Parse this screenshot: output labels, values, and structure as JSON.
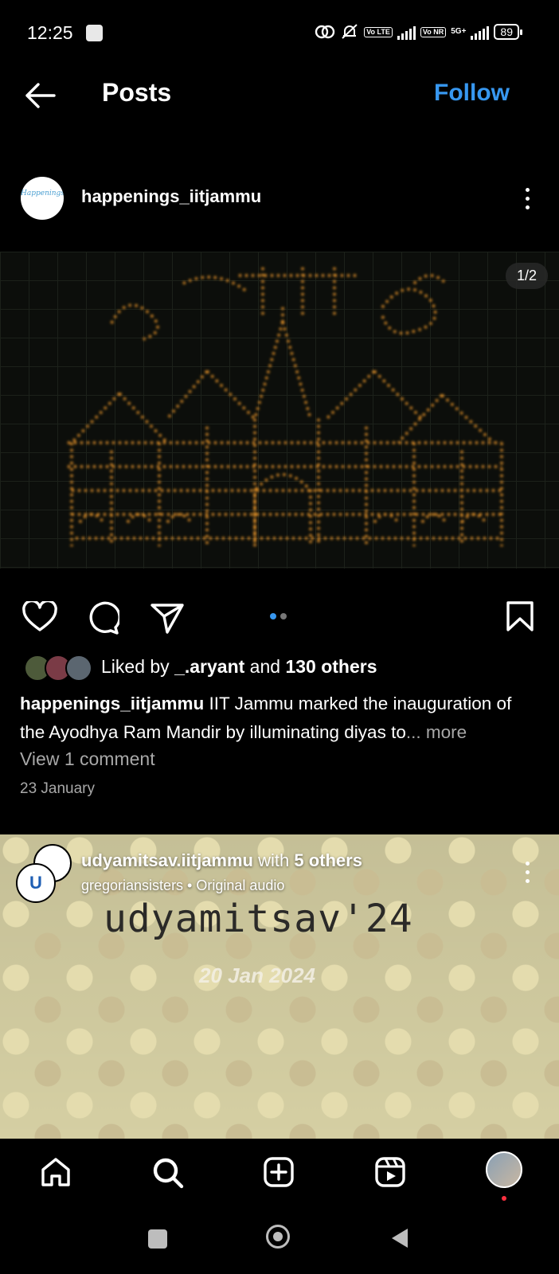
{
  "status_bar": {
    "time": "12:25",
    "network_labels": [
      "Vo LTE",
      "Vo NR",
      "5G+"
    ],
    "battery": "89"
  },
  "header": {
    "title": "Posts",
    "follow_label": "Follow",
    "accent_color": "#3797f0"
  },
  "post1": {
    "username": "happenings_iitjammu",
    "avatar_text": "Happenings",
    "carousel_counter": "1/2",
    "carousel_position": 1,
    "carousel_total": 2,
    "liked_by_prefix": "Liked by ",
    "liked_by_user": "_.aryant",
    "liked_by_mid": " and ",
    "liked_by_others": "130 others",
    "caption_user": "happenings_iitjammu",
    "caption_text": " IIT Jammu marked the inauguration of the Ayodhya Ram Mandir by illuminating diyas to",
    "caption_more": "... more",
    "view_comments": "View 1 comment",
    "date": "23 January"
  },
  "post2": {
    "username": "udyamitsav.iitjammu",
    "with_text": " with ",
    "with_others": "5 others",
    "audio": "gregoriansisters • Original audio",
    "image_title": "udyamitsav'24",
    "image_date": "20 Jan 2024"
  },
  "bottom_nav": [
    "home-icon",
    "search-icon",
    "create-icon",
    "reels-icon",
    "profile-avatar"
  ]
}
